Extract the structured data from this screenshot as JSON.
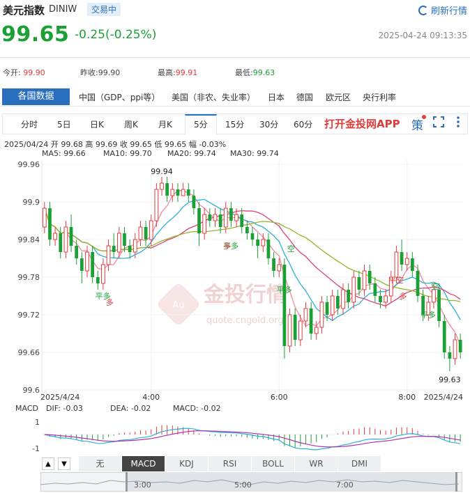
{
  "header": {
    "title": "美元指数",
    "code": "DINIW",
    "status_badge": "交易中",
    "refresh_label": "刷新行情",
    "price": "99.65",
    "change": "-0.25(-0.25%)",
    "datetime": "2025-04-24 09:13:35",
    "up_color": "#e03c3c",
    "down_color": "#1aa034",
    "accent_color": "#2a6fbd"
  },
  "stats": [
    {
      "label": "今开:",
      "value": "99.90",
      "tone": "r"
    },
    {
      "label": "昨收:",
      "value": "99.90",
      "tone": ""
    },
    {
      "label": "最高:",
      "value": "99.91",
      "tone": "r"
    },
    {
      "label": "最低:",
      "value": "99.63",
      "tone": "g"
    }
  ],
  "data_tabs": {
    "active": "各国数据",
    "items": [
      "中国（GDP、ppi等）",
      "美国（非农、失业率）",
      "日本",
      "德国",
      "欧元区",
      "央行利率"
    ]
  },
  "period_tabs": {
    "items": [
      "分时",
      "5日",
      "日K",
      "周K",
      "月K",
      "5分",
      "15分",
      "30分",
      "60分"
    ],
    "active_index": 5,
    "app_link": "打开金投网APP",
    "strategy_label": "策"
  },
  "info_line": "2025/04/24  开 99.68  高 99.69  收 99.65  低 99.65  幅 -0.03%",
  "ma_lines": [
    {
      "label": "MA5: 99.66",
      "color": "#f08aa0"
    },
    {
      "label": "MA10: 99.70",
      "color": "#2bb0d8"
    },
    {
      "label": "MA20: 99.74",
      "color": "#d9427a"
    },
    {
      "label": "MA30: 99.74",
      "color": "#93b52a"
    }
  ],
  "chart_data": {
    "type": "candlestick",
    "interval": "5分",
    "y_ticks": [
      "99.96",
      "99.9",
      "99.84",
      "99.78",
      "99.72",
      "99.66",
      "99.6"
    ],
    "ylim": [
      99.6,
      99.96
    ],
    "x_ticks": [
      {
        "label": "2025/4/24",
        "index": 0
      },
      {
        "label": "4:00",
        "index": 20
      },
      {
        "label": "6:00",
        "index": 44
      },
      {
        "label": "8:00",
        "index": 68
      },
      {
        "label": "2025/4/24",
        "index": 77
      }
    ],
    "annotations": {
      "high": "99.94",
      "low": "99.63"
    },
    "signals": [
      {
        "text": "平多",
        "index": 9
      },
      {
        "text": "多",
        "index": 11
      },
      {
        "text": "平多",
        "index": 33
      },
      {
        "text": "多",
        "index": 33
      },
      {
        "text": "平多",
        "index": 43
      },
      {
        "text": "空",
        "index": 45
      },
      {
        "text": "平空",
        "index": 64
      },
      {
        "text": "多",
        "index": 66
      },
      {
        "text": "平多",
        "index": 70
      },
      {
        "text": "空",
        "index": 72
      }
    ],
    "candles": [
      [
        99.86,
        99.89,
        99.85,
        99.9
      ],
      [
        99.89,
        99.84,
        99.83,
        99.9
      ],
      [
        99.84,
        99.85,
        99.83,
        99.86
      ],
      [
        99.85,
        99.82,
        99.81,
        99.86
      ],
      [
        99.82,
        99.86,
        99.81,
        99.87
      ],
      [
        99.86,
        99.83,
        99.82,
        99.88
      ],
      [
        99.83,
        99.81,
        99.8,
        99.84
      ],
      [
        99.81,
        99.79,
        99.77,
        99.82
      ],
      [
        99.79,
        99.82,
        99.78,
        99.83
      ],
      [
        99.82,
        99.78,
        99.77,
        99.83
      ],
      [
        99.78,
        99.77,
        99.76,
        99.79
      ],
      [
        99.77,
        99.8,
        99.76,
        99.81
      ],
      [
        99.8,
        99.83,
        99.79,
        99.84
      ],
      [
        99.83,
        99.82,
        99.81,
        99.85
      ],
      [
        99.82,
        99.85,
        99.81,
        99.86
      ],
      [
        99.85,
        99.83,
        99.82,
        99.86
      ],
      [
        99.83,
        99.82,
        99.81,
        99.84
      ],
      [
        99.82,
        99.84,
        99.81,
        99.85
      ],
      [
        99.84,
        99.86,
        99.83,
        99.87
      ],
      [
        99.86,
        99.84,
        99.83,
        99.87
      ],
      [
        99.84,
        99.87,
        99.83,
        99.88
      ],
      [
        99.87,
        99.92,
        99.86,
        99.93
      ],
      [
        99.92,
        99.93,
        99.91,
        99.94
      ],
      [
        99.93,
        99.91,
        99.9,
        99.94
      ],
      [
        99.91,
        99.92,
        99.9,
        99.93
      ],
      [
        99.92,
        99.91,
        99.9,
        99.93
      ],
      [
        99.91,
        99.92,
        99.91,
        99.93
      ],
      [
        99.92,
        99.91,
        99.9,
        99.93
      ],
      [
        99.91,
        99.89,
        99.88,
        99.92
      ],
      [
        99.89,
        99.85,
        99.83,
        99.9
      ],
      [
        99.85,
        99.88,
        99.84,
        99.89
      ],
      [
        99.88,
        99.87,
        99.86,
        99.89
      ],
      [
        99.87,
        99.88,
        99.86,
        99.89
      ],
      [
        99.88,
        99.86,
        99.85,
        99.89
      ],
      [
        99.86,
        99.89,
        99.85,
        99.9
      ],
      [
        99.89,
        99.87,
        99.86,
        99.9
      ],
      [
        99.87,
        99.88,
        99.86,
        99.89
      ],
      [
        99.88,
        99.86,
        99.85,
        99.89
      ],
      [
        99.86,
        99.85,
        99.84,
        99.87
      ],
      [
        99.85,
        99.84,
        99.83,
        99.86
      ],
      [
        99.84,
        99.83,
        99.81,
        99.85
      ],
      [
        99.83,
        99.84,
        99.82,
        99.85
      ],
      [
        99.84,
        99.81,
        99.8,
        99.85
      ],
      [
        99.81,
        99.79,
        99.78,
        99.82
      ],
      [
        99.79,
        99.8,
        99.78,
        99.81
      ],
      [
        99.8,
        99.67,
        99.65,
        99.81
      ],
      [
        99.67,
        99.72,
        99.66,
        99.73
      ],
      [
        99.72,
        99.68,
        99.67,
        99.73
      ],
      [
        99.68,
        99.71,
        99.67,
        99.72
      ],
      [
        99.71,
        99.73,
        99.7,
        99.74
      ],
      [
        99.73,
        99.69,
        99.68,
        99.74
      ],
      [
        99.69,
        99.7,
        99.68,
        99.71
      ],
      [
        99.7,
        99.74,
        99.69,
        99.75
      ],
      [
        99.74,
        99.72,
        99.71,
        99.75
      ],
      [
        99.72,
        99.75,
        99.71,
        99.76
      ],
      [
        99.75,
        99.73,
        99.72,
        99.76
      ],
      [
        99.73,
        99.76,
        99.72,
        99.77
      ],
      [
        99.76,
        99.74,
        99.73,
        99.77
      ],
      [
        99.74,
        99.78,
        99.73,
        99.79
      ],
      [
        99.78,
        99.76,
        99.75,
        99.79
      ],
      [
        99.76,
        99.79,
        99.75,
        99.8
      ],
      [
        99.79,
        99.77,
        99.76,
        99.8
      ],
      [
        99.77,
        99.75,
        99.74,
        99.78
      ],
      [
        99.75,
        99.74,
        99.73,
        99.76
      ],
      [
        99.74,
        99.75,
        99.73,
        99.76
      ],
      [
        99.75,
        99.78,
        99.74,
        99.79
      ],
      [
        99.78,
        99.82,
        99.77,
        99.83
      ],
      [
        99.82,
        99.8,
        99.79,
        99.84
      ],
      [
        99.8,
        99.81,
        99.79,
        99.82
      ],
      [
        99.81,
        99.79,
        99.78,
        99.82
      ],
      [
        99.79,
        99.75,
        99.74,
        99.8
      ],
      [
        99.75,
        99.72,
        99.71,
        99.76
      ],
      [
        99.72,
        99.74,
        99.71,
        99.75
      ],
      [
        99.74,
        99.76,
        99.73,
        99.77
      ],
      [
        99.76,
        99.71,
        99.7,
        99.77
      ],
      [
        99.71,
        99.66,
        99.65,
        99.72
      ],
      [
        99.66,
        99.65,
        99.63,
        99.67
      ],
      [
        99.65,
        99.68,
        99.64,
        99.69
      ],
      [
        99.68,
        99.66,
        99.65,
        99.69
      ]
    ],
    "macd": {
      "labels": [
        "MACD",
        "DIF: -0.03",
        "DEA: -0.02",
        "MACD: -0.02"
      ],
      "colors": [
        "#555555",
        "#2bb0d8",
        "#b030b0",
        "#e03c3c"
      ],
      "y_ticks": [
        "1",
        "-1"
      ]
    }
  },
  "indicator_tabs": {
    "items": [
      "无",
      "MACD",
      "KDJ",
      "RSI",
      "BOLL",
      "WR",
      "DMI"
    ],
    "active_index": 1,
    "arrows": [
      "▲",
      "▼"
    ]
  },
  "navigator": {
    "ticks": [
      "3:00",
      "5:00",
      "7:00"
    ]
  },
  "watermark": {
    "text": "金投行情",
    "sub": "quote.cngold.org",
    "badge": "Au"
  }
}
